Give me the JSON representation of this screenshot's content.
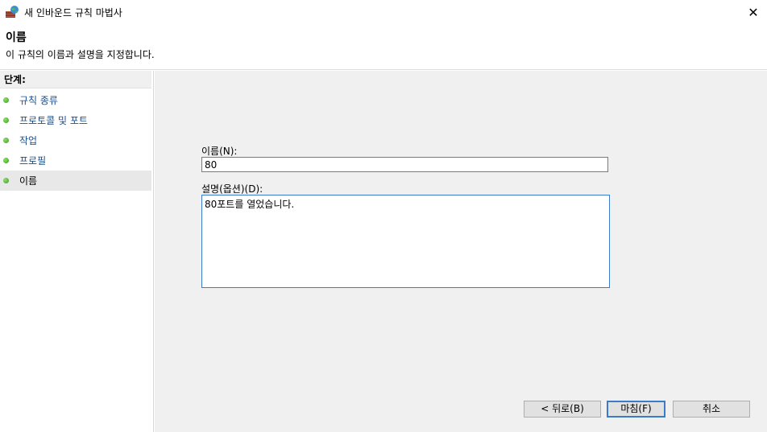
{
  "window": {
    "title": "새 인바운드 규칙 마법사",
    "icon": "firewall-globe-icon",
    "close_glyph": "✕"
  },
  "header": {
    "title": "이름",
    "subtitle": "이 규칙의 이름과 설명을 지정합니다."
  },
  "sidebar": {
    "header": "단계:",
    "steps": [
      {
        "label": "규칙 종류"
      },
      {
        "label": "프로토콜 및 포트"
      },
      {
        "label": "작업"
      },
      {
        "label": "프로필"
      },
      {
        "label": "이름"
      }
    ],
    "active_step": "이름"
  },
  "form": {
    "name_label": "이름(N):",
    "name_value": "80",
    "description_label": "설명(옵션)(D):",
    "description_value": "80포트를 열었습니다."
  },
  "buttons": {
    "back": "< 뒤로(B)",
    "finish": "마침(F)",
    "cancel": "취소"
  },
  "colors": {
    "step_link": "#1a4e8a",
    "step_dot": "#3c9a22",
    "focus_border": "#3b7bc7",
    "panel_bg": "#f0f0f0"
  }
}
